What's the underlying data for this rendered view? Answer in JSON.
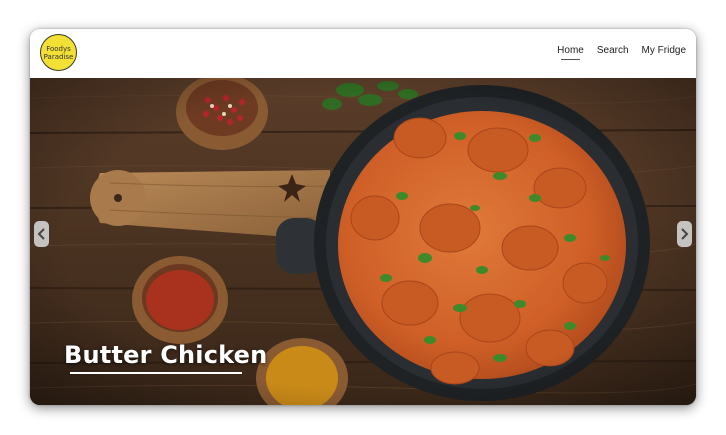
{
  "logo": {
    "text": "Foodys Paradise"
  },
  "nav": {
    "items": [
      {
        "label": "Home",
        "active": true
      },
      {
        "label": "Search",
        "active": false
      },
      {
        "label": "My Fridge",
        "active": false
      }
    ]
  },
  "hero": {
    "title": "Butter Chicken",
    "prev_icon": "chevron-left-icon",
    "next_icon": "chevron-right-icon"
  },
  "colors": {
    "logo_fill": "#f3e035",
    "wood": "#4b3323",
    "curry": "#d2622a",
    "pan": "#26292c"
  }
}
